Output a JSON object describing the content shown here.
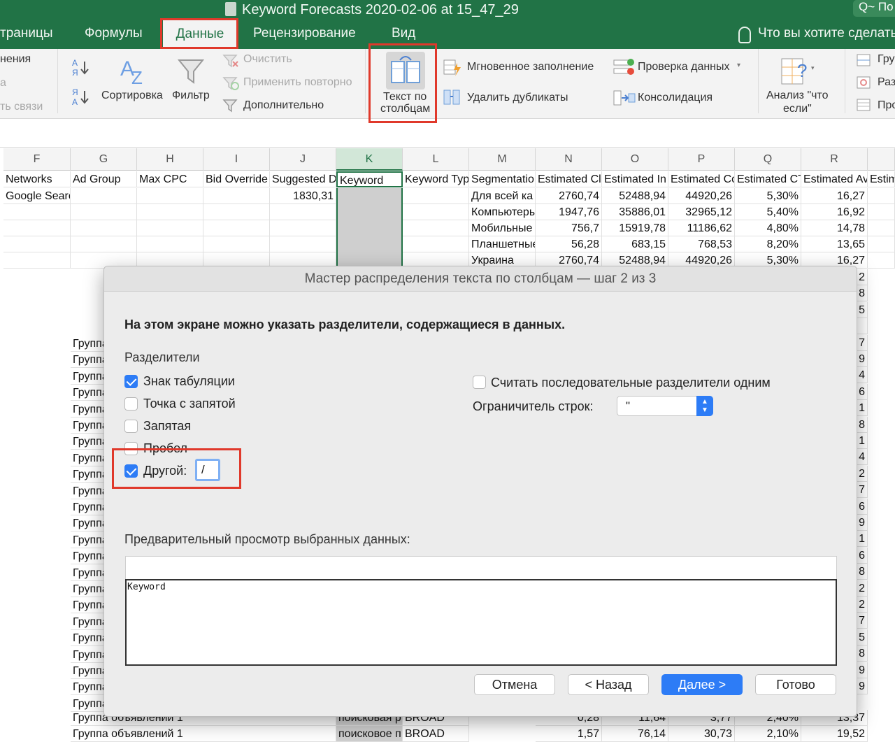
{
  "window": {
    "title": "Keyword Forecasts 2020-02-06 at 15_47_29",
    "search_partial": "Q~ По"
  },
  "tabs": {
    "page_layout_partial": "траницы",
    "formulas": "Формулы",
    "data": "Данные",
    "review": "Рецензирование",
    "view": "Вид",
    "tell_me": "Что вы хотите сделать"
  },
  "ribbon": {
    "left_partial_1": "нения",
    "left_partial_2": "а",
    "left_partial_3": "ть связи",
    "sort": "Сортировка",
    "filter": "Фильтр",
    "clear": "Очистить",
    "reapply": "Применить повторно",
    "advanced": "Дополнительно",
    "text_to_columns_line1": "Текст по",
    "text_to_columns_line2": "столбцам",
    "flash_fill": "Мгновенное заполнение",
    "remove_duplicates": "Удалить дубликаты",
    "data_validation": "Проверка данных",
    "consolidate": "Консолидация",
    "whatif_line1": "Анализ \"что",
    "whatif_line2": "если\"",
    "right_partial_1": "Гру",
    "right_partial_2": "Раз",
    "right_partial_3": "Про"
  },
  "columns": [
    "F",
    "G",
    "H",
    "I",
    "J",
    "K",
    "L",
    "M",
    "N",
    "O",
    "P",
    "Q",
    "R"
  ],
  "header_row": [
    "Networks",
    "Ad Group",
    "Max CPC",
    "Bid Override",
    "Suggested D",
    "Keyword",
    "Keyword Typ",
    "Segmentatio",
    "Estimated Cl",
    "Estimated In",
    "Estimated Co",
    "Estimated CT",
    "Estimated Av",
    "Estim"
  ],
  "rows_top": [
    {
      "F": "Google Search",
      "J": "1830,31",
      "M": "Для всей ка",
      "N": "2760,74",
      "O": "52488,94",
      "P": "44920,26",
      "Q": "5,30%",
      "R": "16,27"
    },
    {
      "F": "",
      "J": "",
      "M": "Компьютеры",
      "N": "1947,76",
      "O": "35886,01",
      "P": "32965,12",
      "Q": "5,40%",
      "R": "16,92"
    },
    {
      "F": "",
      "J": "",
      "M": "Мобильные",
      "N": "756,7",
      "O": "15919,78",
      "P": "11186,62",
      "Q": "4,80%",
      "R": "14,78"
    },
    {
      "F": "",
      "J": "",
      "M": "Планшетные",
      "N": "56,28",
      "O": "683,15",
      "P": "768,53",
      "Q": "8,20%",
      "R": "13,65"
    },
    {
      "F": "",
      "J": "",
      "M": "Украина",
      "N": "2760,74",
      "O": "52488,94",
      "P": "44920,26",
      "Q": "5,30%",
      "R": "16,27"
    }
  ],
  "side_group_partial": "Группа",
  "right_digits": [
    "2",
    "8",
    "5",
    "",
    "7",
    "9",
    "4",
    "6",
    "1",
    "8",
    "1",
    "4",
    "2",
    "7",
    "6",
    "9",
    "1",
    "6",
    "8",
    "2",
    "2",
    "7",
    "5",
    "8",
    "9",
    "9"
  ],
  "rows_bottom": [
    {
      "G": "Группа объявлений 1",
      "K": "поисковая р",
      "L": "BROAD",
      "N": "0,28",
      "O": "11,64",
      "P": "3,77",
      "Q": "2,40%",
      "R": "13,37"
    },
    {
      "G": "Группа объявлений 1",
      "K": "поисковое п",
      "L": "BROAD",
      "N": "1,57",
      "O": "76,14",
      "P": "30,73",
      "Q": "2,10%",
      "R": "19,52"
    }
  ],
  "dialog": {
    "title": "Мастер распределения текста по столбцам — шаг 2 из 3",
    "heading": "На этом экране можно указать разделители, содержащиеся в данных.",
    "delimiters_label": "Разделители",
    "tab": "Знак табуляции",
    "semicolon": "Точка с запятой",
    "comma": "Запятая",
    "space": "Пробел",
    "other": "Другой:",
    "other_value": "/",
    "consecutive": "Считать последовательные разделители одним",
    "text_qualifier_label": "Ограничитель строк:",
    "text_qualifier_value": "\"",
    "preview_label": "Предварительный просмотр выбранных данных:",
    "preview_text": "Keyword",
    "cancel": "Отмена",
    "back": "< Назад",
    "next": "Далее >",
    "finish": "Готово"
  },
  "state": {
    "tab_checked": true,
    "semicolon_checked": false,
    "comma_checked": false,
    "space_checked": false,
    "other_checked": true,
    "consecutive_checked": false
  },
  "colors": {
    "excel_green": "#217346",
    "highlight_red": "#e0392b",
    "mac_blue": "#2d7cf6"
  }
}
